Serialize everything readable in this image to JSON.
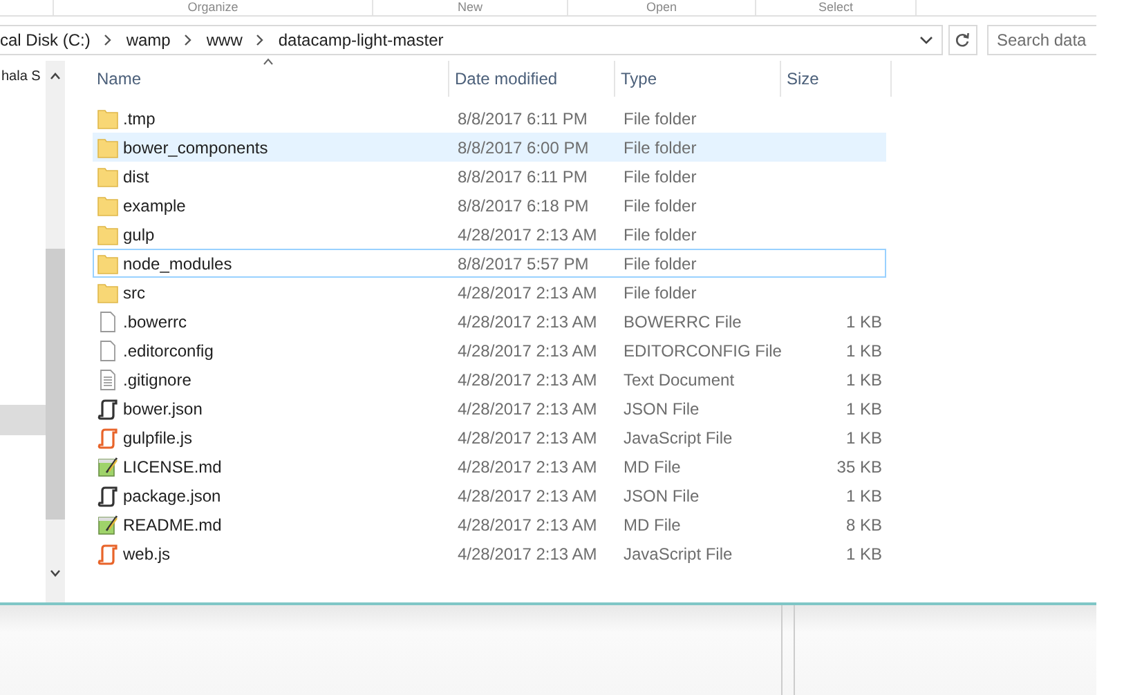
{
  "ribbon": {
    "groups": [
      "Organize",
      "New",
      "Open",
      "Select"
    ]
  },
  "address_bar": {
    "crumbs": [
      "cal Disk (C:)",
      "wamp",
      "www",
      "datacamp-light-master"
    ]
  },
  "search": {
    "placeholder": "Search data"
  },
  "sidebar": {
    "items": [
      "hala S"
    ]
  },
  "table": {
    "columns": [
      "Name",
      "Date modified",
      "Type",
      "Size"
    ],
    "rows": [
      {
        "kind": "folder",
        "name": ".tmp",
        "date": "8/8/2017 6:11 PM",
        "type": "File folder",
        "highlighted": false,
        "focused": false
      },
      {
        "kind": "folder",
        "name": "bower_components",
        "date": "8/8/2017 6:00 PM",
        "type": "File folder",
        "highlighted": true,
        "focused": false
      },
      {
        "kind": "folder",
        "name": "dist",
        "date": "8/8/2017 6:11 PM",
        "type": "File folder",
        "highlighted": false,
        "focused": false
      },
      {
        "kind": "folder",
        "name": "example",
        "date": "8/8/2017 6:18 PM",
        "type": "File folder",
        "highlighted": false,
        "focused": false
      },
      {
        "kind": "folder",
        "name": "gulp",
        "date": "4/28/2017 2:13 AM",
        "type": "File folder",
        "highlighted": false,
        "focused": false
      },
      {
        "kind": "folder",
        "name": "node_modules",
        "date": "8/8/2017 5:57 PM",
        "type": "File folder",
        "highlighted": false,
        "focused": true
      },
      {
        "kind": "folder",
        "name": "src",
        "date": "4/28/2017 2:13 AM",
        "type": "File folder",
        "highlighted": false,
        "focused": false
      },
      {
        "kind": "blank",
        "name": ".bowerrc",
        "date": "4/28/2017 2:13 AM",
        "type": "BOWERRC File",
        "size": "1 KB",
        "highlighted": false,
        "focused": false
      },
      {
        "kind": "blank",
        "name": ".editorconfig",
        "date": "4/28/2017 2:13 AM",
        "type": "EDITORCONFIG File",
        "size": "1 KB",
        "highlighted": false,
        "focused": false
      },
      {
        "kind": "text",
        "name": ".gitignore",
        "date": "4/28/2017 2:13 AM",
        "type": "Text Document",
        "size": "1 KB",
        "highlighted": false,
        "focused": false
      },
      {
        "kind": "script",
        "name": "bower.json",
        "date": "4/28/2017 2:13 AM",
        "type": "JSON File",
        "size": "1 KB",
        "highlighted": false,
        "focused": false
      },
      {
        "kind": "js",
        "name": "gulpfile.js",
        "date": "4/28/2017 2:13 AM",
        "type": "JavaScript File",
        "size": "1 KB",
        "highlighted": false,
        "focused": false
      },
      {
        "kind": "notepad",
        "name": "LICENSE.md",
        "date": "4/28/2017 2:13 AM",
        "type": "MD File",
        "size": "35 KB",
        "highlighted": false,
        "focused": false
      },
      {
        "kind": "script",
        "name": "package.json",
        "date": "4/28/2017 2:13 AM",
        "type": "JSON File",
        "size": "1 KB",
        "highlighted": false,
        "focused": false
      },
      {
        "kind": "notepad",
        "name": "README.md",
        "date": "4/28/2017 2:13 AM",
        "type": "MD File",
        "size": "8 KB",
        "highlighted": false,
        "focused": false
      },
      {
        "kind": "js",
        "name": "web.js",
        "date": "4/28/2017 2:13 AM",
        "type": "JavaScript File",
        "size": "1 KB",
        "highlighted": false,
        "focused": false
      }
    ]
  }
}
